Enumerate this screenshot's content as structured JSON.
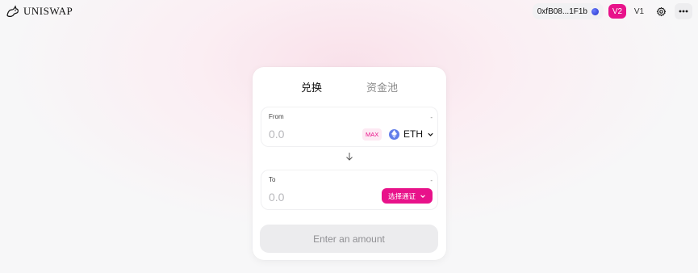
{
  "header": {
    "logo_text": "UNISWAP",
    "account_label": "0xfB08...1F1b",
    "version_active": "V2",
    "version_other": "V1"
  },
  "swap": {
    "tabs": [
      "兑换",
      "资金池"
    ],
    "active_tab": 0,
    "from": {
      "label": "From",
      "balance": "-",
      "amount_placeholder": "0.0",
      "max_label": "MAX",
      "token_symbol": "ETH"
    },
    "to": {
      "label": "To",
      "balance": "-",
      "amount_placeholder": "0.0",
      "select_token_label": "选择通证"
    },
    "submit_label": "Enter an amount"
  },
  "icons": {
    "logo": "unicorn-logo-icon",
    "account_status": "wallet-dot-icon",
    "settings": "gear-icon",
    "more": "more-dots-icon",
    "eth": "eth-icon",
    "swap_direction": "arrow-down-icon",
    "dropdown": "chevron-down-icon"
  },
  "colors": {
    "accent": "#e8128a",
    "eth": "#627eea",
    "button_disabled_bg": "#ececee"
  }
}
